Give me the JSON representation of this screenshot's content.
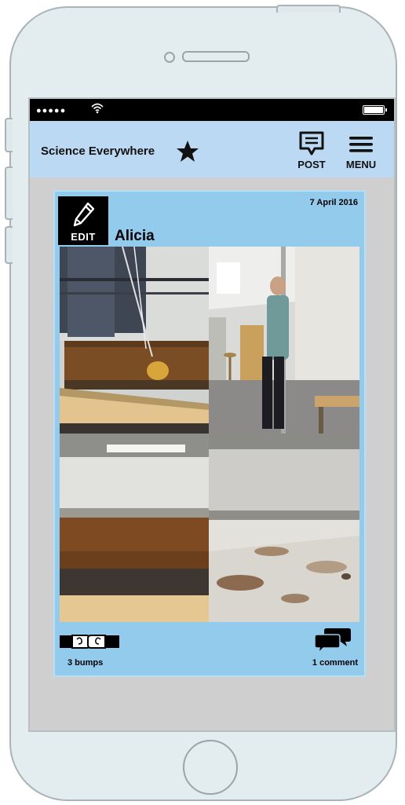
{
  "app": {
    "title": "Science Everywhere",
    "status": {
      "signal": "●●●●●"
    }
  },
  "toolbar": {
    "post_label": "POST",
    "menu_label": "MENU",
    "icons": [
      "star-icon",
      "post-icon",
      "menu-icon"
    ]
  },
  "post": {
    "edit_label": "EDIT",
    "author": "Alicia",
    "date": "7 April 2016",
    "photos": [
      {
        "description": "tank with brown water"
      },
      {
        "description": "person in classroom"
      },
      {
        "description": "close-up of tank water"
      },
      {
        "description": "close-up of tank bottom"
      }
    ],
    "bumps_label": "3 bumps",
    "comments_label": "1 comment"
  },
  "colors": {
    "app_bar": "#bcd9f3",
    "card": "#93cbec",
    "screen_bg": "#cfcfcf",
    "status_bar": "#000000"
  }
}
